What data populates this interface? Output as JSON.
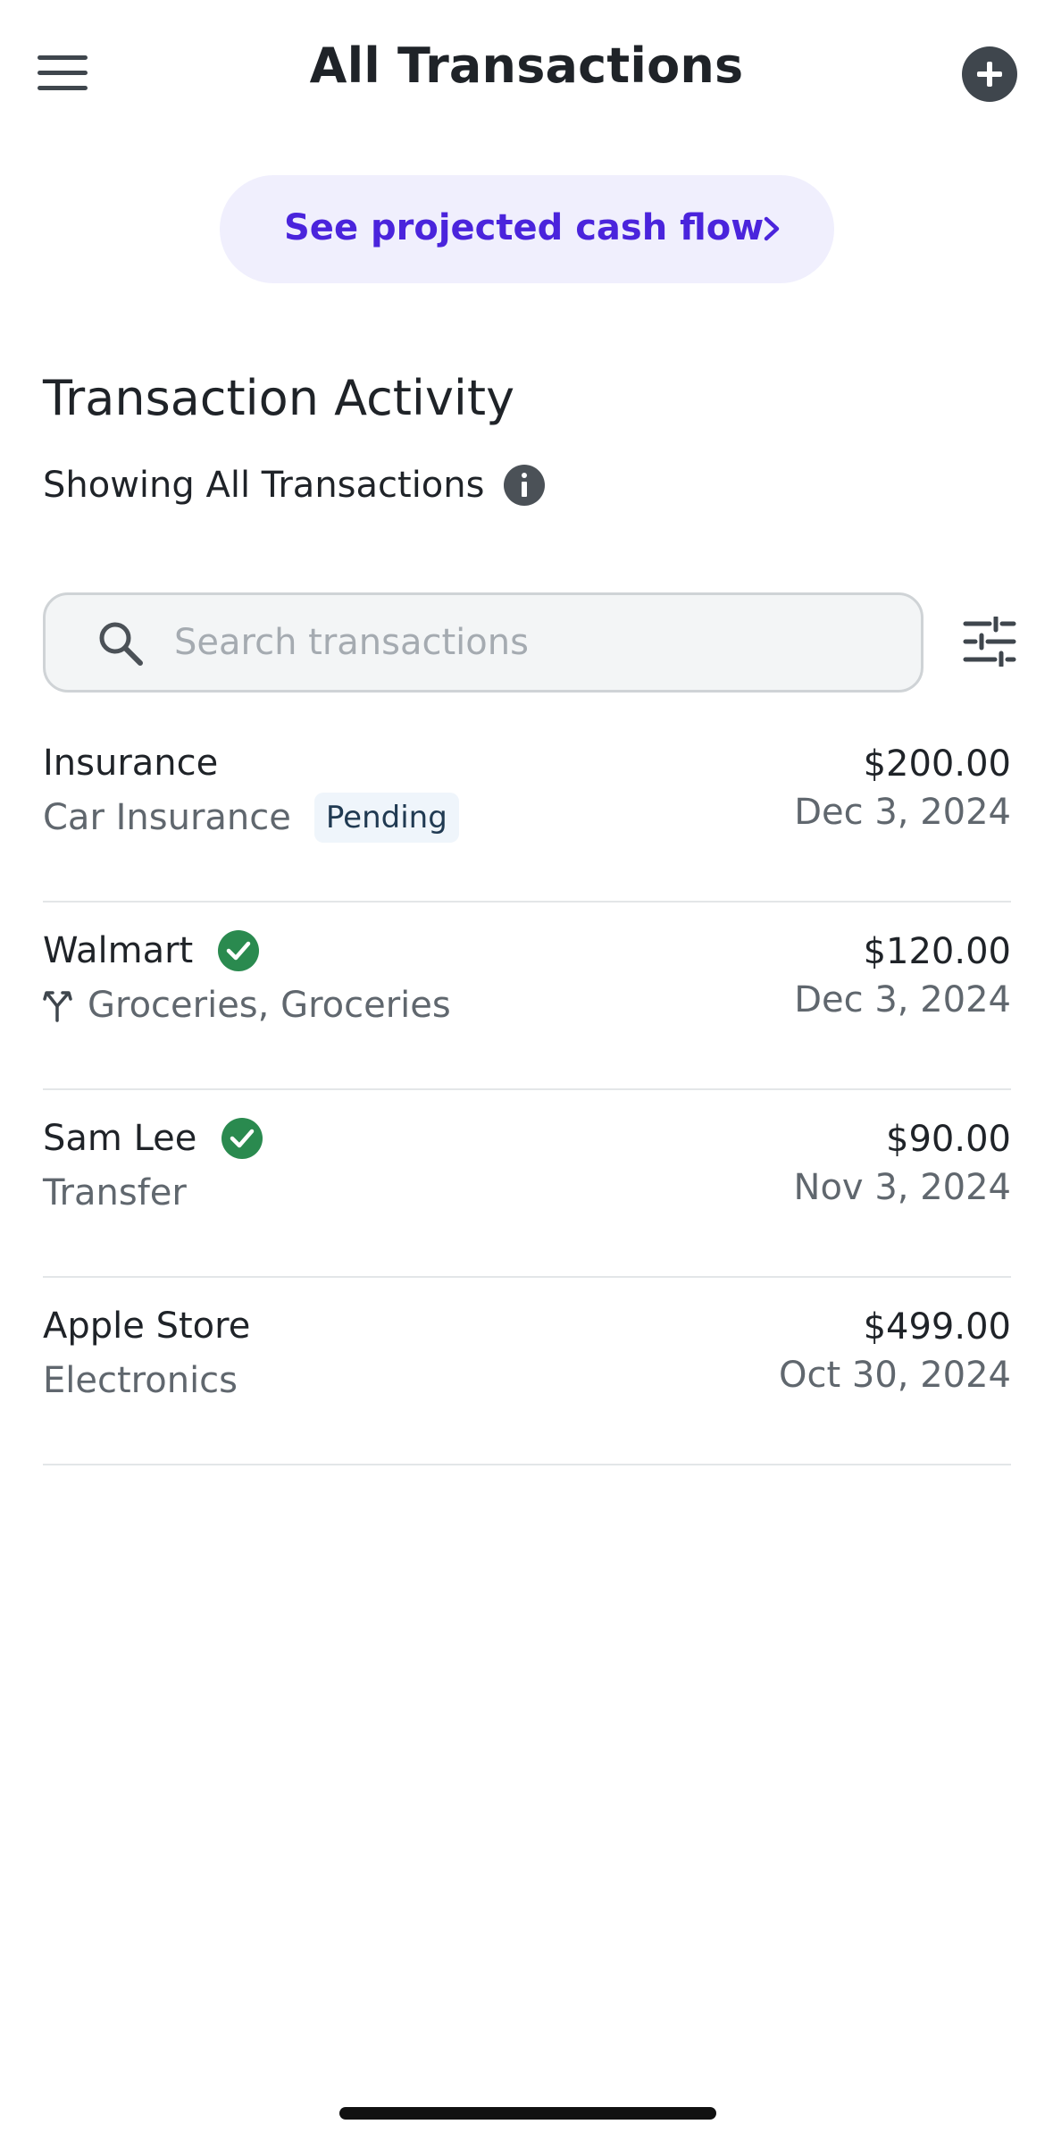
{
  "header": {
    "title": "All Transactions",
    "menu_icon": "hamburger-menu-icon",
    "add_icon": "plus-circle-icon"
  },
  "cashflow": {
    "label": "See projected cash flow",
    "icon": "chevron-right-icon",
    "accent_color": "#4a24dc",
    "background_color": "#f0effd"
  },
  "activity": {
    "title": "Transaction Activity",
    "showing": "Showing All Transactions",
    "info_icon": "info-icon"
  },
  "search": {
    "placeholder": "Search transactions",
    "value": "",
    "icon": "search-icon",
    "filter_icon": "sliders-filter-icon"
  },
  "transactions": [
    {
      "name": "Insurance",
      "category": "Car Insurance",
      "badge": "Pending",
      "amount": "$200.00",
      "date": "Dec 3, 2024",
      "verified": false,
      "split": false
    },
    {
      "name": "Walmart",
      "category": "Groceries, Groceries",
      "badge": "",
      "amount": "$120.00",
      "date": "Dec 3, 2024",
      "verified": true,
      "split": true
    },
    {
      "name": "Sam Lee",
      "category": "Transfer",
      "badge": "",
      "amount": "$90.00",
      "date": "Nov 3, 2024",
      "verified": true,
      "split": false
    },
    {
      "name": "Apple Store",
      "category": "Electronics",
      "badge": "",
      "amount": "$499.00",
      "date": "Oct 30, 2024",
      "verified": false,
      "split": false
    }
  ],
  "colors": {
    "verified_green": "#2a8a4f",
    "icon_dark": "#3f464d",
    "divider": "#e3e6e8"
  }
}
